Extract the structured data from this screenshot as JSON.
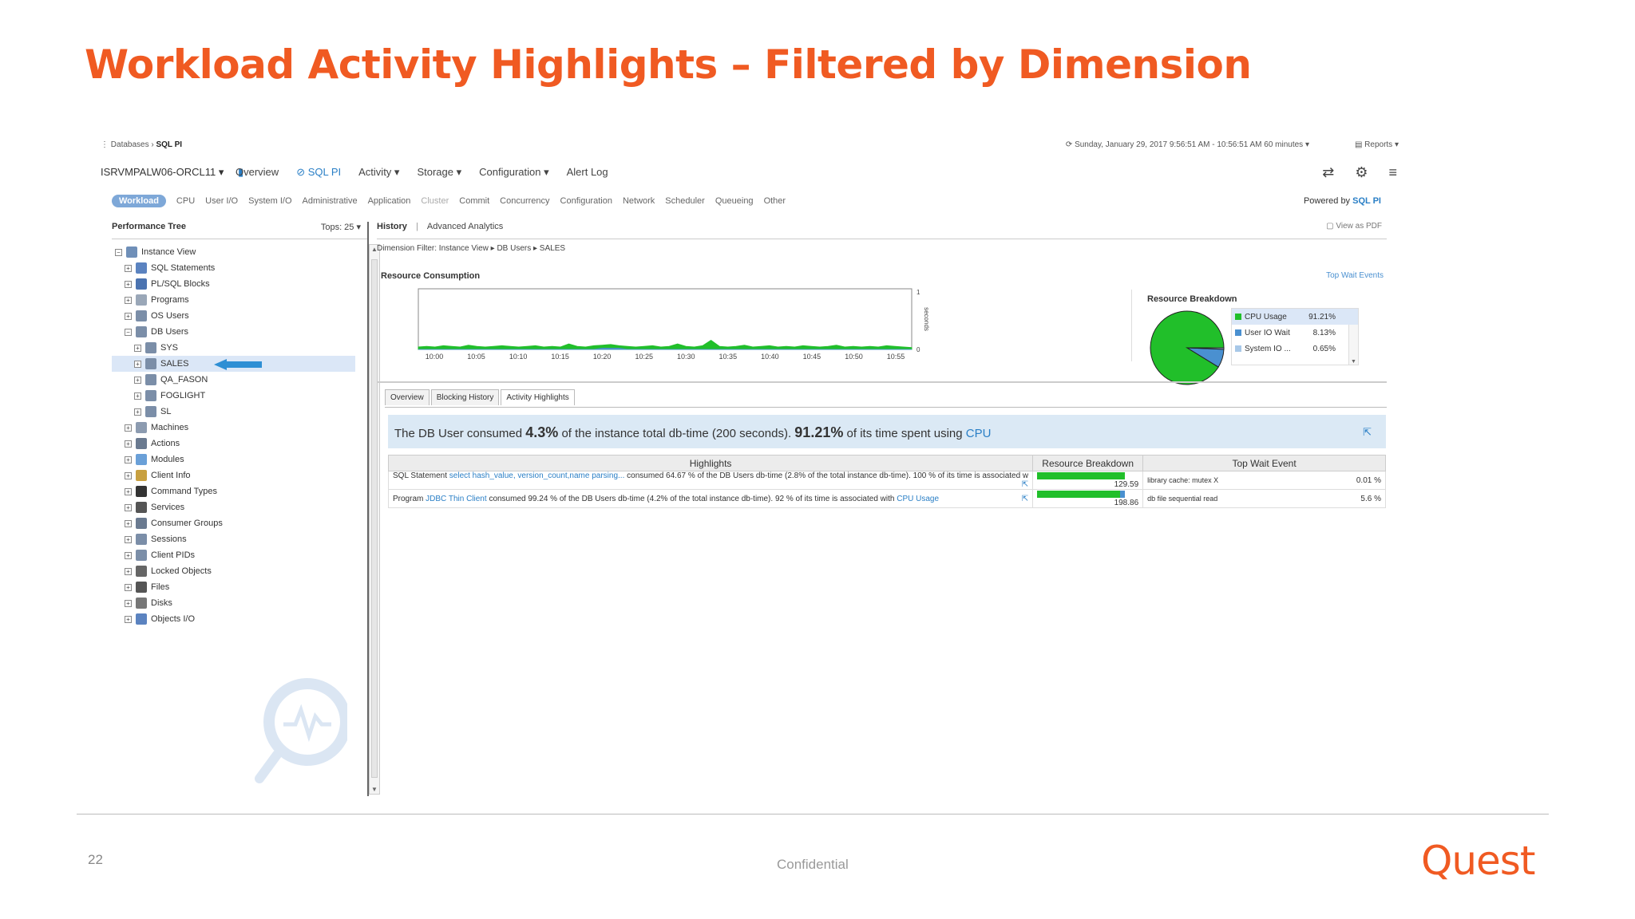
{
  "slide": {
    "title": "Workload Activity Highlights – Filtered by Dimension",
    "page_number": "22",
    "confidential": "Confidential",
    "logo": "Quest"
  },
  "topbar": {
    "breadcrumb_root": "Databases",
    "breadcrumb_current": "SQL PI",
    "datetime": "Sunday, January 29, 2017 9:56:51 AM - 10:56:51 AM 60 minutes",
    "reports": "Reports"
  },
  "navbar": {
    "host": "ISRVMPALW06-ORCL11",
    "items": [
      "Overview",
      "SQL PI",
      "Activity",
      "Storage",
      "Configuration",
      "Alert Log"
    ],
    "icons": [
      "refresh-icon",
      "gear-icon",
      "menu-icon"
    ]
  },
  "subnav": {
    "active": "Workload",
    "items": [
      "CPU",
      "User I/O",
      "System I/O",
      "Administrative",
      "Application",
      "Cluster",
      "Commit",
      "Concurrency",
      "Configuration",
      "Network",
      "Scheduler",
      "Queueing",
      "Other"
    ],
    "powered_by": "Powered by",
    "powered_brand": "SQL PI"
  },
  "tree": {
    "title": "Performance Tree",
    "tops": "Tops: 25",
    "items": [
      {
        "label": "Instance View",
        "level": 0,
        "exp": "−",
        "color": "#6f8fb8"
      },
      {
        "label": "SQL Statements",
        "level": 1,
        "exp": "+",
        "color": "#5b83c0"
      },
      {
        "label": "PL/SQL Blocks",
        "level": 1,
        "exp": "+",
        "color": "#4b73b0"
      },
      {
        "label": "Programs",
        "level": 1,
        "exp": "+",
        "color": "#9aa7b8"
      },
      {
        "label": "OS Users",
        "level": 1,
        "exp": "+",
        "color": "#7b8ea8"
      },
      {
        "label": "DB Users",
        "level": 1,
        "exp": "−",
        "color": "#7b8ea8"
      },
      {
        "label": "SYS",
        "level": 2,
        "exp": "+",
        "color": "#7b8ea8"
      },
      {
        "label": "SALES",
        "level": 2,
        "exp": "+",
        "color": "#7b8ea8",
        "selected": true
      },
      {
        "label": "QA_FASON",
        "level": 2,
        "exp": "+",
        "color": "#7b8ea8"
      },
      {
        "label": "FOGLIGHT",
        "level": 2,
        "exp": "+",
        "color": "#7b8ea8"
      },
      {
        "label": "SL",
        "level": 2,
        "exp": "+",
        "color": "#7b8ea8"
      },
      {
        "label": "Machines",
        "level": 1,
        "exp": "+",
        "color": "#8c9bb0"
      },
      {
        "label": "Actions",
        "level": 1,
        "exp": "+",
        "color": "#6a7a90"
      },
      {
        "label": "Modules",
        "level": 1,
        "exp": "+",
        "color": "#6aa0d8"
      },
      {
        "label": "Client Info",
        "level": 1,
        "exp": "+",
        "color": "#c8a040"
      },
      {
        "label": "Command Types",
        "level": 1,
        "exp": "+",
        "color": "#333333"
      },
      {
        "label": "Services",
        "level": 1,
        "exp": "+",
        "color": "#555555"
      },
      {
        "label": "Consumer Groups",
        "level": 1,
        "exp": "+",
        "color": "#6a7a90"
      },
      {
        "label": "Sessions",
        "level": 1,
        "exp": "+",
        "color": "#7b8ea8"
      },
      {
        "label": "Client PIDs",
        "level": 1,
        "exp": "+",
        "color": "#7b8ea8"
      },
      {
        "label": "Locked Objects",
        "level": 1,
        "exp": "+",
        "color": "#666666"
      },
      {
        "label": "Files",
        "level": 1,
        "exp": "+",
        "color": "#555555"
      },
      {
        "label": "Disks",
        "level": 1,
        "exp": "+",
        "color": "#777777"
      },
      {
        "label": "Objects I/O",
        "level": 1,
        "exp": "+",
        "color": "#5b83c0"
      }
    ]
  },
  "main": {
    "tab_history": "History",
    "tab_analytics": "Advanced Analytics",
    "view_pdf": "View as PDF",
    "dimension_filter": "Dimension Filter: Instance View ▸ DB Users ▸ SALES",
    "resource_consumption": "Resource Consumption",
    "top_wait_events": "Top Wait Events",
    "resource_breakdown_title": "Resource Breakdown",
    "sub_tabs": [
      "Overview",
      "Blocking History",
      "Activity Highlights"
    ],
    "summary": {
      "p1": "The DB User consumed",
      "v1": "4.3%",
      "p2": "of the instance total db-time (200 seconds).",
      "v2": "91.21%",
      "p3": "of its time spent using",
      "v3": "CPU"
    },
    "table": {
      "headers": [
        "Highlights",
        "Resource Breakdown",
        "Top Wait Event"
      ],
      "rows": [
        {
          "kind": "SQL Statement",
          "link": "select hash_value, version_count,name parsing...",
          "text": "consumed 64.67 % of the DB Users db-time (2.8% of the total instance db-time). 100 % of its time is associated w",
          "value": "129.59",
          "wait": "library cache: mutex X",
          "wait_pct": "0.01 %"
        },
        {
          "kind": "Program",
          "link": "JDBC Thin Client",
          "text": "consumed 99.24 % of the DB Users db-time (4.2% of the total instance db-time). 92 % of its time is associated with",
          "link2": "CPU Usage",
          "value": "198.86",
          "wait": "db file sequential read",
          "wait_pct": "5.6 %"
        }
      ]
    }
  },
  "chart_data": [
    {
      "type": "area",
      "title": "Resource Consumption",
      "ylabel": "seconds",
      "ylim": [
        0,
        1
      ],
      "x_ticks": [
        "10:00",
        "10:05",
        "10:10",
        "10:15",
        "10:20",
        "10:25",
        "10:30",
        "10:35",
        "10:40",
        "10:45",
        "10:50",
        "10:55"
      ],
      "y_ticks": [
        "0",
        "1"
      ],
      "series": [
        {
          "name": "CPU Usage",
          "color": "#21bf2a",
          "values": [
            0.04,
            0.05,
            0.04,
            0.06,
            0.05,
            0.04,
            0.07,
            0.05,
            0.04,
            0.05,
            0.06,
            0.05,
            0.04,
            0.05,
            0.06,
            0.04,
            0.05,
            0.04,
            0.09,
            0.05,
            0.04,
            0.06,
            0.07,
            0.08,
            0.06,
            0.05,
            0.04,
            0.05,
            0.06,
            0.04,
            0.05,
            0.09,
            0.05,
            0.04,
            0.06,
            0.15,
            0.05,
            0.04,
            0.05,
            0.07,
            0.04,
            0.05,
            0.06,
            0.04,
            0.05,
            0.04,
            0.06,
            0.05,
            0.04,
            0.05,
            0.07,
            0.04,
            0.05,
            0.04,
            0.05,
            0.04,
            0.06,
            0.05,
            0.04,
            0.03
          ]
        },
        {
          "name": "User IO Wait",
          "color": "#4a90d0",
          "values": [
            0,
            0,
            0,
            0,
            0,
            0,
            0,
            0,
            0,
            0,
            0,
            0,
            0,
            0,
            0,
            0,
            0,
            0,
            0,
            0,
            0,
            0,
            0.02,
            0.02,
            0.02,
            0,
            0,
            0,
            0,
            0,
            0,
            0,
            0,
            0,
            0,
            0,
            0,
            0,
            0,
            0,
            0,
            0,
            0,
            0,
            0,
            0,
            0,
            0,
            0,
            0,
            0,
            0,
            0,
            0,
            0,
            0,
            0,
            0,
            0,
            0
          ]
        }
      ]
    },
    {
      "type": "pie",
      "title": "Resource Breakdown",
      "categories": [
        "CPU Usage",
        "User IO Wait",
        "System IO ..."
      ],
      "values": [
        91.21,
        8.13,
        0.65
      ],
      "labels": [
        "91.21%",
        "8.13%",
        "0.65%"
      ],
      "colors": [
        "#21bf2a",
        "#4a90d0",
        "#a8c8e8"
      ]
    }
  ]
}
